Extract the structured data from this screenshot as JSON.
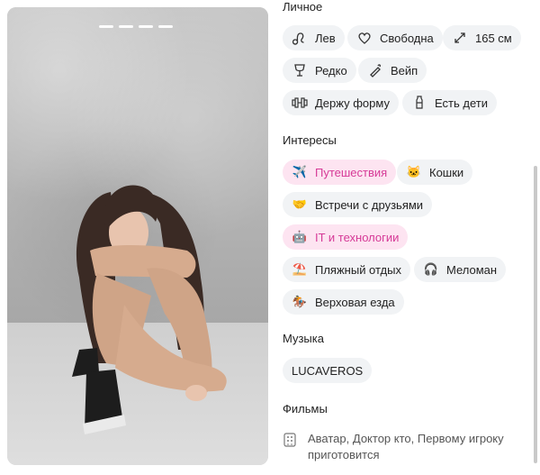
{
  "photo": {
    "indicator_count": 4
  },
  "sections": {
    "personal": "Личное",
    "interests": "Интересы",
    "music": "Музыка",
    "films": "Фильмы"
  },
  "personal_chips": [
    {
      "label": "Лев",
      "icon": "leo-icon"
    },
    {
      "label": "Свободна",
      "icon": "heart-icon"
    },
    {
      "label": "165 см",
      "icon": "height-icon"
    },
    {
      "label": "Редко",
      "icon": "glass-icon"
    },
    {
      "label": "Вейп",
      "icon": "vape-icon"
    },
    {
      "label": "Держу форму",
      "icon": "dumbbell-icon"
    },
    {
      "label": "Есть дети",
      "icon": "bottle-icon"
    }
  ],
  "interest_chips": [
    {
      "label": "Путешествия",
      "icon": "airplane-icon",
      "highlight": true
    },
    {
      "label": "Кошки",
      "icon": "cat-icon",
      "highlight": false
    },
    {
      "label": "Встречи с друзьями",
      "icon": "handshake-icon",
      "highlight": false
    },
    {
      "label": "IT и технологии",
      "icon": "robot-icon",
      "highlight": true
    },
    {
      "label": "Пляжный отдых",
      "icon": "beach-icon",
      "highlight": false
    },
    {
      "label": "Меломан",
      "icon": "headphones-icon",
      "highlight": false
    },
    {
      "label": "Верховая езда",
      "icon": "horse-icon",
      "highlight": false
    }
  ],
  "music": [
    "LUCAVEROS"
  ],
  "films": "Аватар, Доктор кто, Первому игроку приготовится",
  "colors": {
    "chip_bg": "#f1f3f5",
    "chip_pink_bg": "#fde4f1",
    "chip_pink_text": "#d63a97"
  }
}
